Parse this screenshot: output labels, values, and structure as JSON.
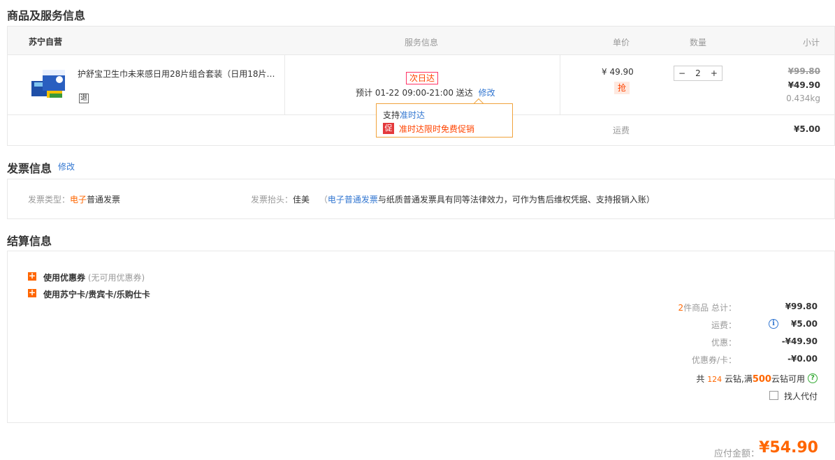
{
  "goods_section": {
    "title": "商品及服务信息",
    "header": {
      "store": "苏宁自营",
      "service": "服务信息",
      "unit_price": "单价",
      "quantity": "数量",
      "subtotal": "小计"
    },
    "item": {
      "name": "护舒宝卫生巾未来感日用28片组合套装（日用18片…",
      "return_icon_text": "退",
      "next_day_tag": "次日达",
      "delivery_estimate": "预计 01-22 09:00-21:00 送达",
      "modify_link": "修改",
      "unit_price": "¥ 49.90",
      "qiang_badge": "抢",
      "quantity_value": "2",
      "minus": "−",
      "plus": "+",
      "original_total": "¥99.80",
      "total": "¥49.90",
      "weight": "0.434kg"
    },
    "popup": {
      "support_prefix": "支持",
      "support_link": "准时达",
      "promo_badge": "促",
      "promo_text": "准时达限时免费促销"
    },
    "shipping_label": "运费",
    "shipping_value": "¥5.00"
  },
  "invoice_section": {
    "title": "发票信息",
    "modify_link": "修改",
    "type_label": "发票类型：",
    "type_highlight": "电子",
    "type_rest": "普通发票",
    "header_label": "发票抬头：",
    "header_value": "佳美",
    "note_open": "（",
    "note_link": "电子普通发票",
    "note_rest": "与纸质普通发票具有同等法律效力，可作为售后维权凭据、支持报销入账）"
  },
  "settlement_section": {
    "title": "结算信息",
    "coupon_label": "使用优惠券",
    "coupon_note": "(无可用优惠券)",
    "card_label": "使用苏宁卡/贵宾卡/乐购仕卡",
    "plus_icon_text": "+",
    "item_count": "2",
    "total_label": "件商品  总计：",
    "total_value": "¥99.80",
    "shipping_label": "运费：",
    "shipping_value": "¥5.00",
    "discount_label": "优惠：",
    "discount_value": "-¥49.90",
    "coupon_card_label": "优惠券/卡：",
    "coupon_card_value": "-¥0.00",
    "diamond_prefix": "共",
    "diamond_count": "124",
    "diamond_mid": "云钻,满",
    "diamond_threshold": "500",
    "diamond_suffix": "云钻可用",
    "proxy_pay_label": "找人代付",
    "payable_label": "应付金额：",
    "payable_value": "¥54.90"
  },
  "colors": {
    "accent_orange": "#ff6600",
    "link_blue": "#3377d1",
    "border": "#e8e8e8"
  }
}
